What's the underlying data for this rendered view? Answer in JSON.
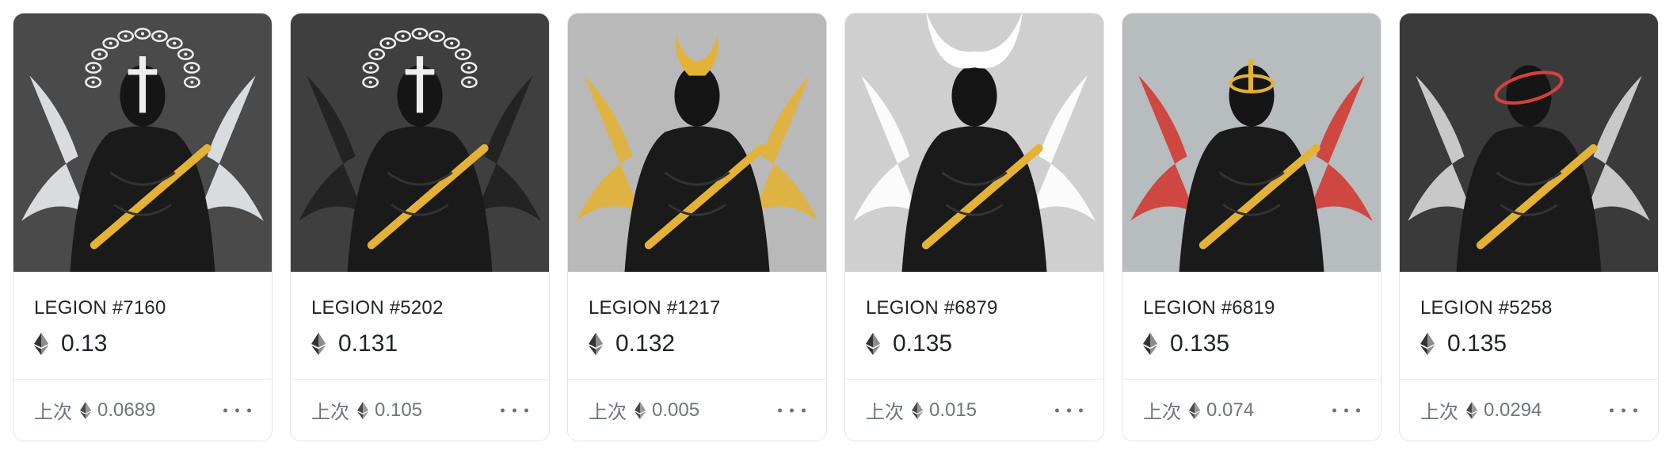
{
  "currency_icon": "ethereum-icon",
  "last_label": "上次",
  "more_icon": "ellipsis-icon",
  "cards": [
    {
      "name": "LEGION #7160",
      "price": "0.13",
      "last": "0.0689",
      "bg": "#4a4a4a",
      "accent": "#e3b236",
      "wing": "#e8ecef",
      "halo": "eyes-cross"
    },
    {
      "name": "LEGION #5202",
      "price": "0.131",
      "last": "0.105",
      "bg": "#3f3f3f",
      "accent": "#e3b236",
      "wing": "#202020",
      "halo": "eyes-cross"
    },
    {
      "name": "LEGION #1217",
      "price": "0.132",
      "last": "0.005",
      "bg": "#b9b9b9",
      "accent": "#e3b236",
      "wing": "#e3b236",
      "halo": "horns"
    },
    {
      "name": "LEGION #6879",
      "price": "0.135",
      "last": "0.015",
      "bg": "#cfcfcf",
      "accent": "#e3b236",
      "wing": "#ffffff",
      "halo": "white-horns"
    },
    {
      "name": "LEGION #6819",
      "price": "0.135",
      "last": "0.074",
      "bg": "#b7bcbe",
      "accent": "#e3b236",
      "wing": "#d23a33",
      "halo": "gold-ring"
    },
    {
      "name": "LEGION #5258",
      "price": "0.135",
      "last": "0.0294",
      "bg": "#3a3a3a",
      "accent": "#e3b236",
      "wing": "#d8d8d8",
      "halo": "red-ring"
    }
  ]
}
